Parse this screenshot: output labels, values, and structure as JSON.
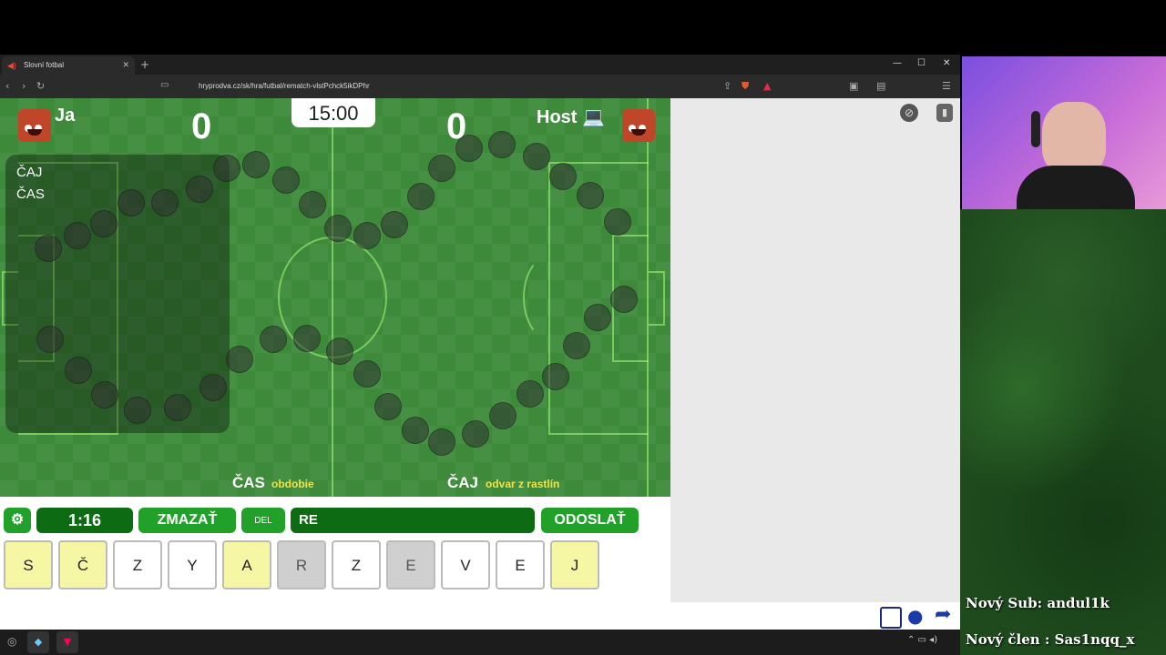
{
  "browser": {
    "tab_title": "Slovní fotbal",
    "url": "hryprodva.cz/sk/hra/futbal/rematch-vlstPchck5ikDPhr"
  },
  "game": {
    "timer": "15:00",
    "player_left": {
      "name": "Ja",
      "score": "0"
    },
    "player_right": {
      "name": "Host 💻",
      "score": "0"
    },
    "history_words": [
      "ČAJ",
      "ČAS"
    ],
    "word_left": {
      "word": "ČAS",
      "meaning": "obdobie"
    },
    "word_right": {
      "word": "ČAJ",
      "meaning": "odvar z rastlín"
    }
  },
  "controls": {
    "settings_icon": "gear-icon",
    "turn_timer": "1:16",
    "clear_label": "ZMAZAŤ",
    "del_label": "DEL",
    "input_value": "RE",
    "send_label": "ODOSLAŤ"
  },
  "tiles": [
    {
      "letter": "S",
      "state": "yellow"
    },
    {
      "letter": "Č",
      "state": "yellow"
    },
    {
      "letter": "Z",
      "state": "white"
    },
    {
      "letter": "Y",
      "state": "white"
    },
    {
      "letter": "A",
      "state": "yellow"
    },
    {
      "letter": "R",
      "state": "gray"
    },
    {
      "letter": "Z",
      "state": "white"
    },
    {
      "letter": "E",
      "state": "gray"
    },
    {
      "letter": "V",
      "state": "white"
    },
    {
      "letter": "E",
      "state": "white"
    },
    {
      "letter": "J",
      "state": "yellow"
    }
  ],
  "stream": {
    "alert_sub": "Nový Sub: andul1k",
    "alert_member": "Nový člen : Sas1nqq_x"
  },
  "colors": {
    "field": "#3c8a3a",
    "button_green": "#22a12a",
    "meaning_yellow": "#f0e34a"
  }
}
